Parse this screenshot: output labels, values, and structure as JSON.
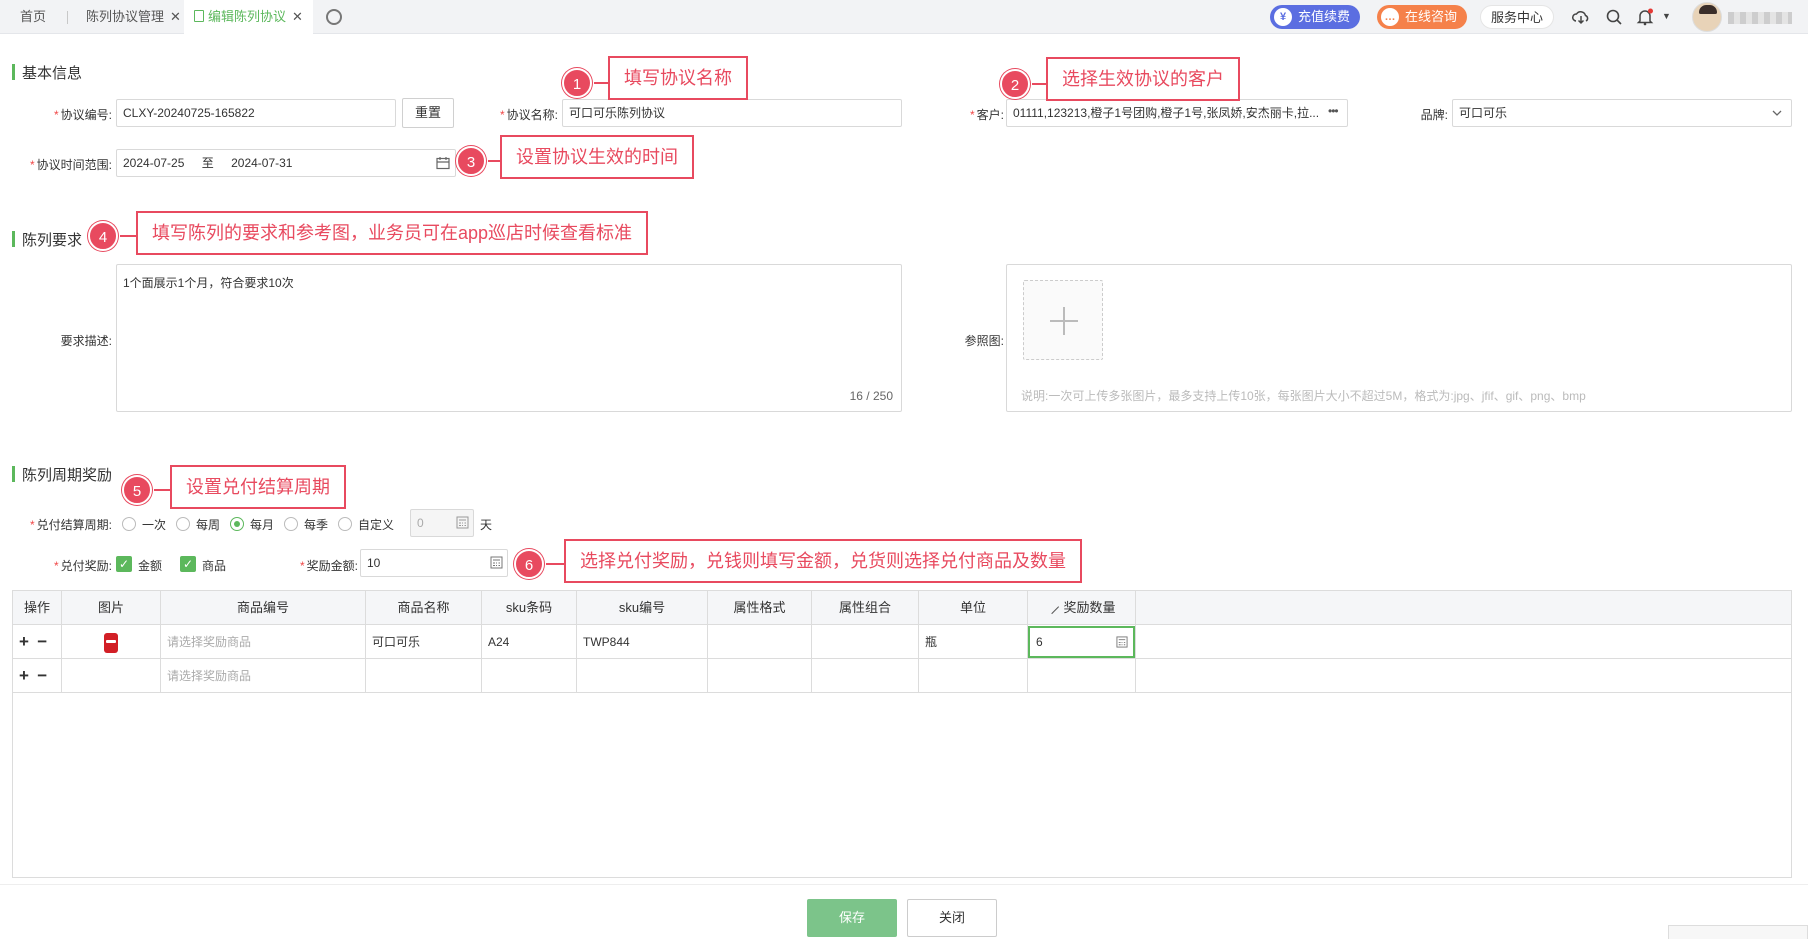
{
  "tabs": [
    {
      "label": "首页"
    },
    {
      "label": "陈列协议管理"
    },
    {
      "label": "编辑陈列协议"
    }
  ],
  "topbar": {
    "recharge": "充值续费",
    "consult": "在线咨询",
    "service": "服务中心"
  },
  "basic": {
    "title": "基本信息",
    "code_label": "协议编号:",
    "code_value": "CLXY-20240725-165822",
    "reset": "重置",
    "name_label": "协议名称:",
    "name_value": "可口可乐陈列协议",
    "customer_label": "客户:",
    "customer_value": "01111,123213,橙子1号团购,橙子1号,张凤娇,安杰丽卡,拉...",
    "brand_label": "品牌:",
    "brand_value": "可口可乐",
    "range_label": "协议时间范围:",
    "range_start": "2024-07-25",
    "range_to": "至",
    "range_end": "2024-07-31"
  },
  "display": {
    "title": "陈列要求",
    "desc_label": "要求描述:",
    "desc_value": "1个面展示1个月，符合要求10次",
    "desc_count": "16 / 250",
    "ref_label": "参照图:",
    "ref_hint": "说明:一次可上传多张图片，最多支持上传10张，每张图片大小不超过5M，格式为:jpg、jfif、gif、png、bmp"
  },
  "reward": {
    "title": "陈列周期奖励",
    "cycle_label": "兑付结算周期:",
    "cycles": [
      "一次",
      "每周",
      "每月",
      "每季",
      "自定义"
    ],
    "cycle_selected": "每月",
    "custom_value": "0",
    "custom_unit": "天",
    "pay_label": "兑付奖励:",
    "pay_cash": "金额",
    "pay_goods": "商品",
    "amount_label": "奖励金额:",
    "amount_value": "10"
  },
  "table": {
    "headers": [
      "操作",
      "图片",
      "商品编号",
      "商品名称",
      "sku条码",
      "sku编号",
      "属性格式",
      "属性组合",
      "单位",
      "奖励数量"
    ],
    "rows": [
      {
        "code": "请选择奖励商品",
        "name": "可口可乐",
        "barcode": "A24",
        "sku": "TWP844",
        "fmt": "",
        "combo": "",
        "unit": "瓶",
        "qty": "6"
      },
      {
        "code": "请选择奖励商品",
        "name": "",
        "barcode": "",
        "sku": "",
        "fmt": "",
        "combo": "",
        "unit": "",
        "qty": ""
      }
    ]
  },
  "footer": {
    "save": "保存",
    "close": "关闭"
  },
  "callouts": [
    {
      "num": "1",
      "text": "填写协议名称"
    },
    {
      "num": "2",
      "text": "选择生效协议的客户"
    },
    {
      "num": "3",
      "text": "设置协议生效的时间"
    },
    {
      "num": "4",
      "text": "填写陈列的要求和参考图，业务员可在app巡店时候查看标准"
    },
    {
      "num": "5",
      "text": "设置兑付结算周期"
    },
    {
      "num": "6",
      "text": "选择兑付奖励，兑钱则填写金额，兑货则选择兑付商品及数量"
    }
  ],
  "colors": {
    "accent": "#5cb85c",
    "callout": "#e84a5f",
    "recharge": "#5b6ee1",
    "consult": "#f5814a"
  }
}
